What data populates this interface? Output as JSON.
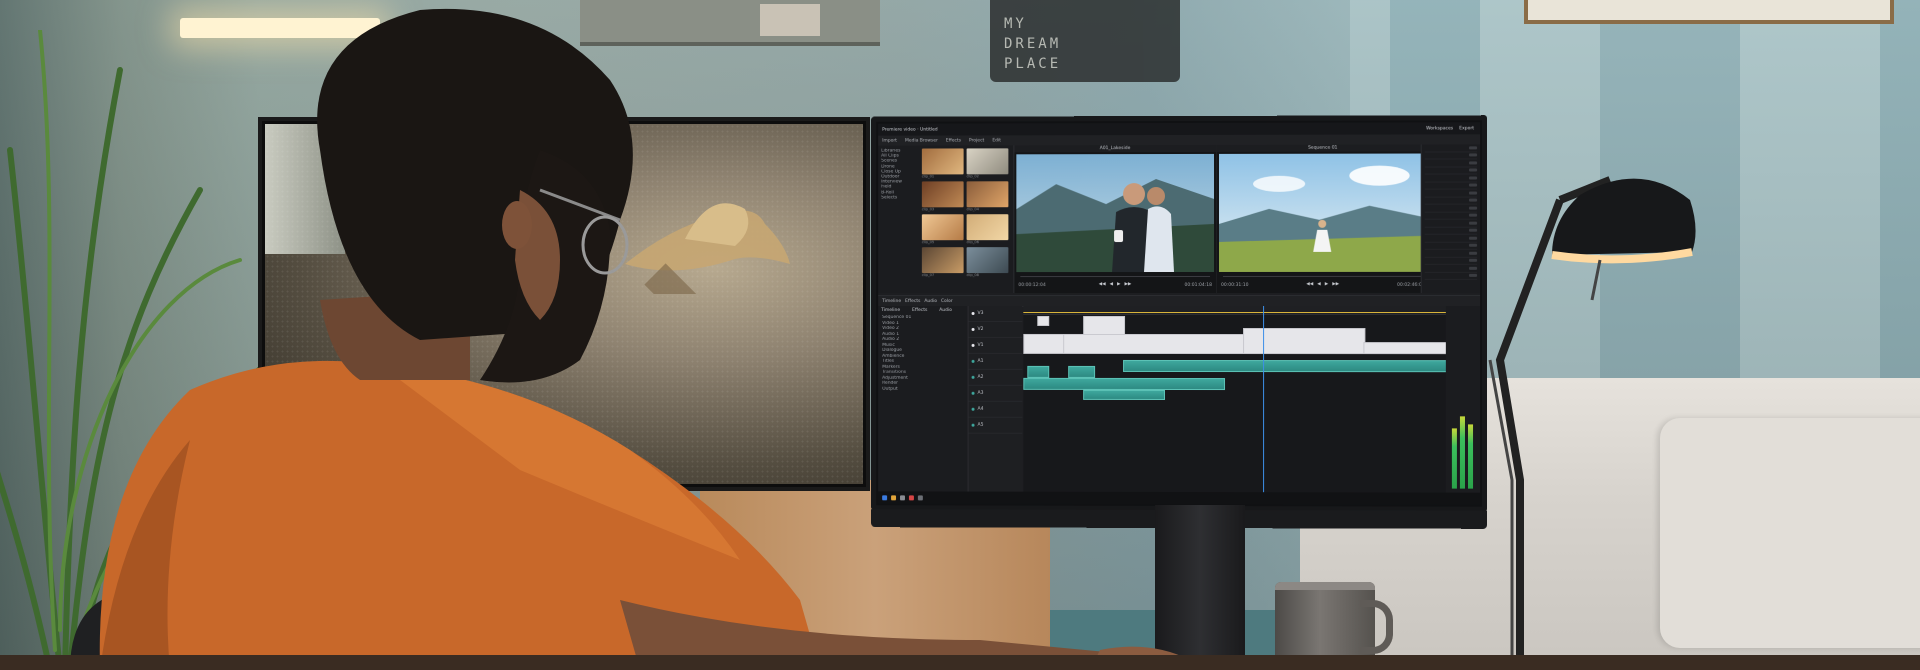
{
  "sign": {
    "line1": "MY",
    "line2": "DREAM",
    "line3": "PLACE"
  },
  "editor": {
    "titlebar": {
      "app_label": "Premiere video · Untitled",
      "right_items": [
        "Workspaces",
        "Export"
      ]
    },
    "toolbar": [
      "Import",
      "Media Browser",
      "Effects",
      "Project",
      "Edit"
    ],
    "media_tree": [
      "Libraries",
      "All Clips",
      "Scenes",
      "Drone",
      "Close Up",
      "Outdoor",
      "Interview",
      "Field",
      "B-Roll",
      "Selects"
    ],
    "thumb_captions": [
      "clip_01",
      "clip_02",
      "clip_03",
      "clip_04",
      "clip_05",
      "clip_06",
      "clip_07",
      "clip_08"
    ],
    "source_viewer": {
      "title": "A01_Lakeside",
      "timecode_left": "00:00:12:04",
      "timecode_right": "00:01:04:18"
    },
    "program_viewer": {
      "title": "Sequence 01",
      "timecode_left": "00:00:31:10",
      "timecode_right": "00:02:46:02"
    },
    "transport": [
      "◀◀",
      "◀",
      "▶",
      "▶▶"
    ],
    "effects_bar": [
      "Timeline",
      "Effects",
      "Audio",
      "Color"
    ],
    "timeline_side": {
      "headers": [
        "Timeline",
        "Effects",
        "Audio"
      ],
      "items": [
        "Sequence 01",
        "Video 1",
        "Video 2",
        "Audio 1",
        "Audio 2",
        "Music",
        "Dialogue",
        "Ambience",
        "Titles",
        "Markers",
        "Transitions",
        "Adjustment",
        "Render",
        "Output"
      ]
    },
    "tracks": [
      "V3",
      "V2",
      "V1",
      "A1",
      "A2",
      "A3",
      "A4",
      "A5"
    ],
    "taskbar_label": ""
  }
}
